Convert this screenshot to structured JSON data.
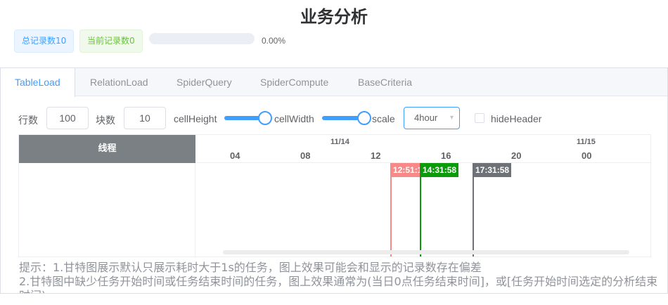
{
  "title": "业务分析",
  "stats": {
    "total_records": "总记录数10",
    "current_records": "当前记录数0",
    "progress_percent": 0,
    "progress_text": "0.00%"
  },
  "tabs": [
    {
      "label": "TableLoad",
      "active": true
    },
    {
      "label": "RelationLoad",
      "active": false
    },
    {
      "label": "SpiderQuery",
      "active": false
    },
    {
      "label": "SpiderCompute",
      "active": false
    },
    {
      "label": "BaseCriteria",
      "active": false
    }
  ],
  "controls": {
    "rows_label": "行数",
    "rows_value": "100",
    "blocks_label": "块数",
    "blocks_value": "10",
    "cell_height_label": "cellHeight",
    "cell_width_label": "cellWidth",
    "scale_label": "scale",
    "scale_value": "4hour",
    "scale_arrow_icon": "chevron-down-icon",
    "hide_header_label": "hideHeader",
    "hide_header_checked": false
  },
  "gantt": {
    "left_header": "线程",
    "dates": [
      "11/14",
      "11/15"
    ],
    "hours": [
      "04",
      "08",
      "12",
      "16",
      "20",
      "00"
    ],
    "markers": [
      {
        "time": "12:51:1",
        "color": "#f78989"
      },
      {
        "time": "14:31:58",
        "color": "#0a9a0a"
      },
      {
        "time": "17:31:58",
        "color": "#6e7276"
      }
    ]
  },
  "hints": [
    "提示：1.甘特图展示默认只展示耗时大于1s的任务，图上效果可能会和显示的记录数存在偏差",
    "2.甘特图中缺少任务开始时间或任务结束时间的任务，图上效果通常为(当日0点任务结束时间]，或[任务开始时间选定的分析结束",
    "时间)"
  ]
}
